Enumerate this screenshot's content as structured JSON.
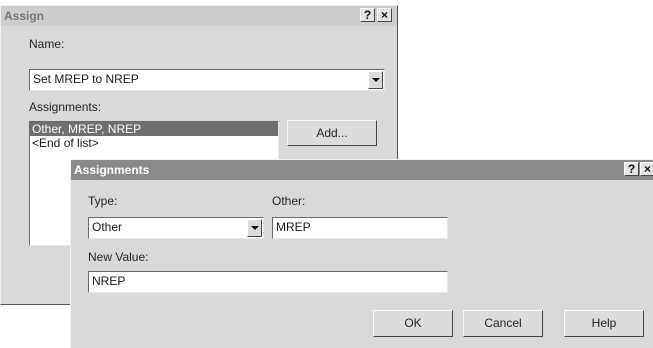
{
  "assign_window": {
    "title": "Assign",
    "help_btn": "?",
    "close_btn": "×",
    "name_label": "Name:",
    "name_value": "Set MREP to NREP",
    "assignments_label": "Assignments:",
    "assignments_list": [
      "Other, MREP, NREP",
      "<End of list>"
    ],
    "add_button": "Add..."
  },
  "assignments_window": {
    "title": "Assignments",
    "help_btn": "?",
    "close_btn": "×",
    "type_label": "Type:",
    "type_value": "Other",
    "other_label": "Other:",
    "other_value": "MREP",
    "new_value_label": "New Value:",
    "new_value_value": "NREP",
    "ok_button": "OK",
    "cancel_button": "Cancel",
    "help_button": "Help"
  }
}
